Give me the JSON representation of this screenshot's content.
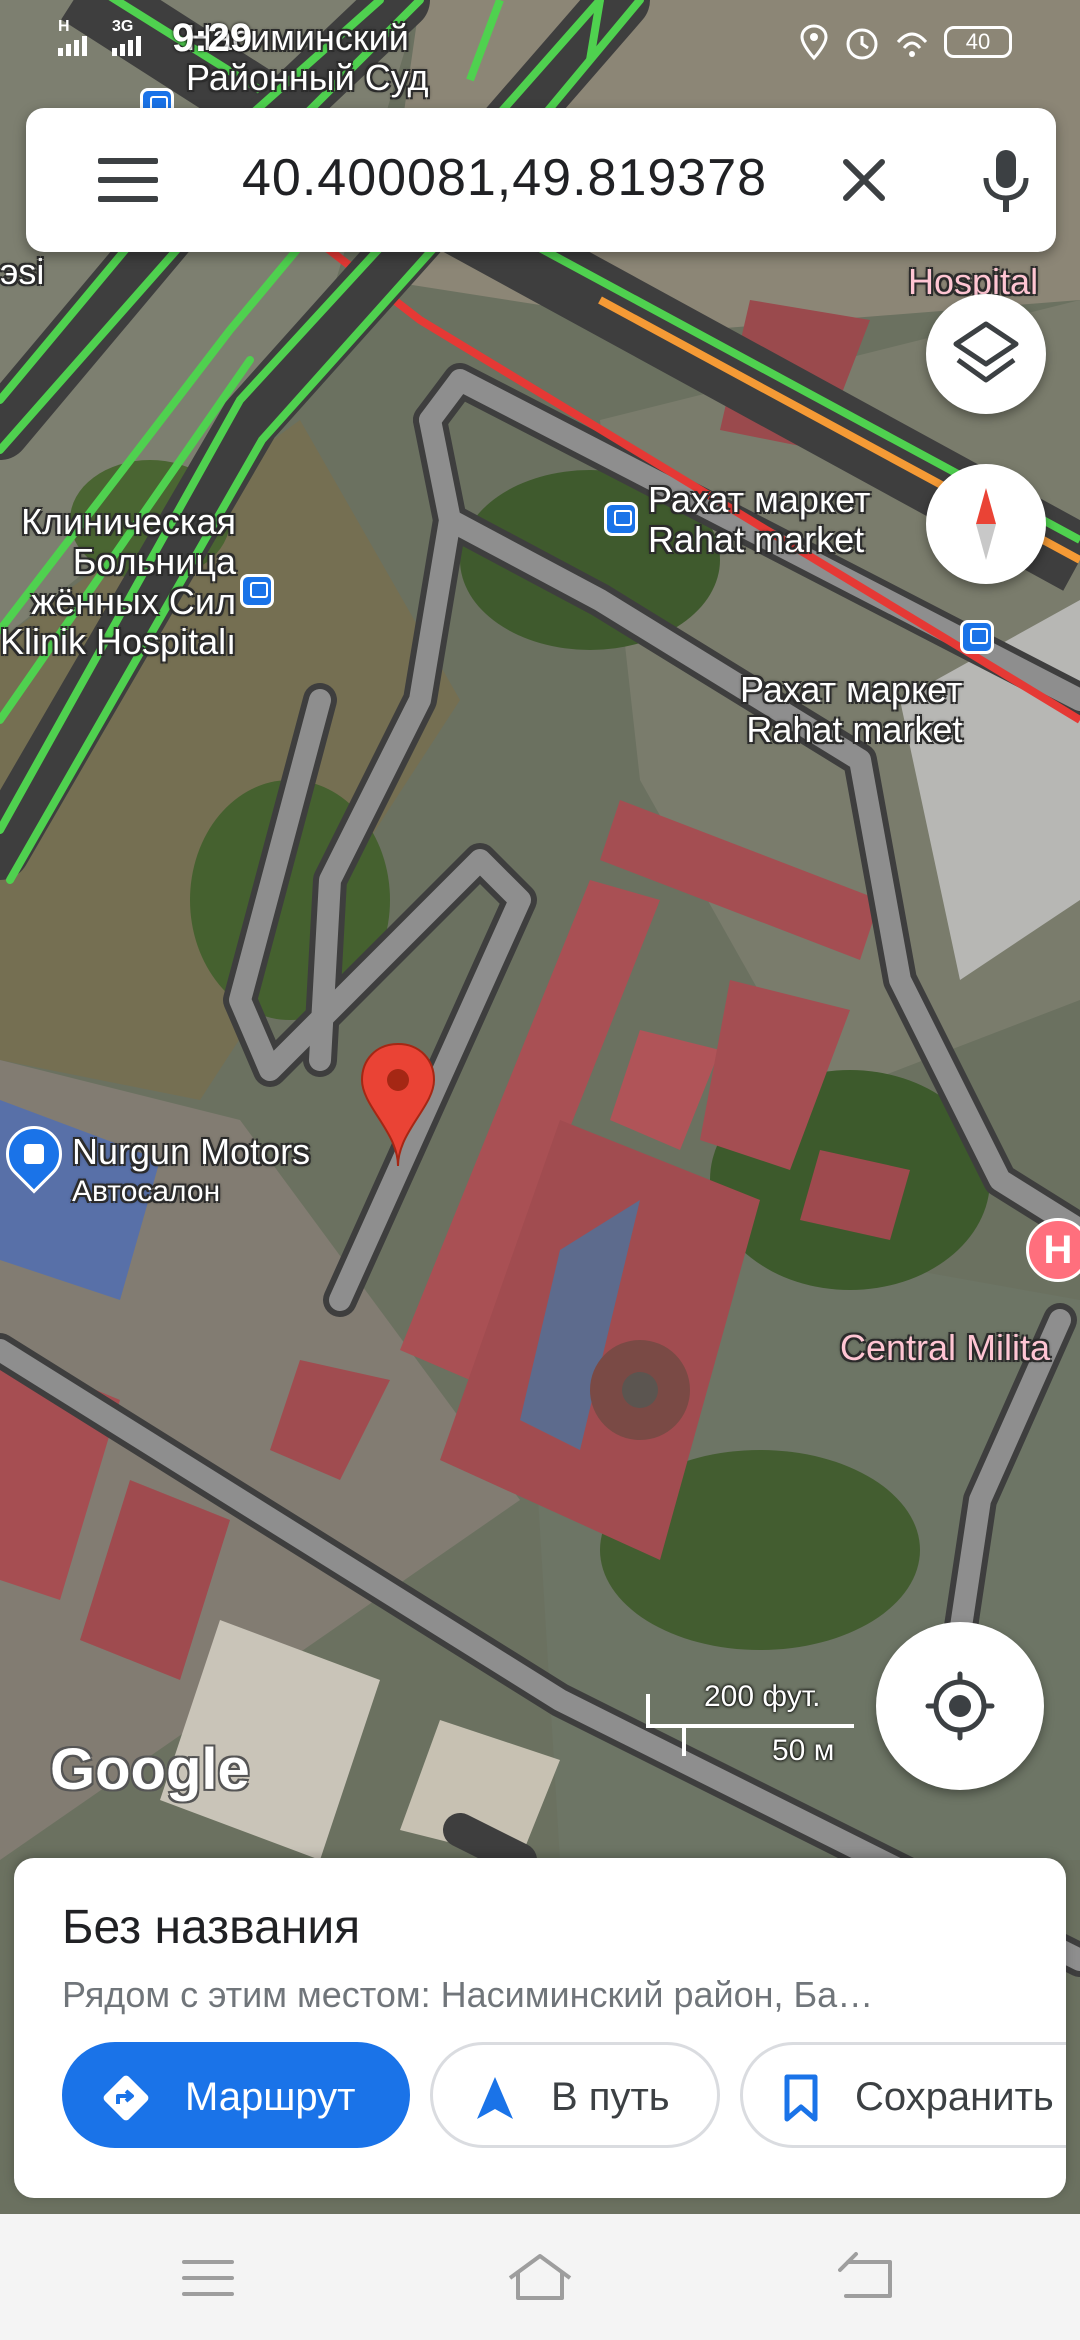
{
  "status_bar": {
    "time": "9:29",
    "network_1": "H",
    "network_2": "3G",
    "battery": "40"
  },
  "search": {
    "query": "40.400081,49.819378"
  },
  "map_labels": {
    "court": [
      "Насиминский",
      "Районный Суд"
    ],
    "hospital_top": "Hospital",
    "rahat_1_ru": "Рахат маркет",
    "rahat_1_en": "Rahat market",
    "rahat_2_ru": "Рахат маркет",
    "rahat_2_en": "Rahat market",
    "clinic": [
      "Клиническая",
      "Больница",
      "жённых Сил",
      "Klinik Hospitalı"
    ],
    "left_edge": [
      "эsi"
    ],
    "nurgun_title": "Nurgun Motors",
    "nurgun_sub": "Автосалон",
    "central": "Central Milita",
    "hospital_pin_letter": "H"
  },
  "scale": {
    "feet": "200 фут.",
    "meters": "50 м"
  },
  "logo": "Google",
  "place": {
    "title": "Без названия",
    "subtitle": "Рядом с этим местом: Насиминский район, Ба…"
  },
  "actions": {
    "route": "Маршрут",
    "go": "В путь",
    "save": "Сохранить"
  },
  "colors": {
    "accent": "#1a73e8",
    "pin": "#ea4335",
    "traffic_green": "#4fd14f",
    "traffic_red": "#e53935",
    "traffic_orange": "#f59a35"
  }
}
